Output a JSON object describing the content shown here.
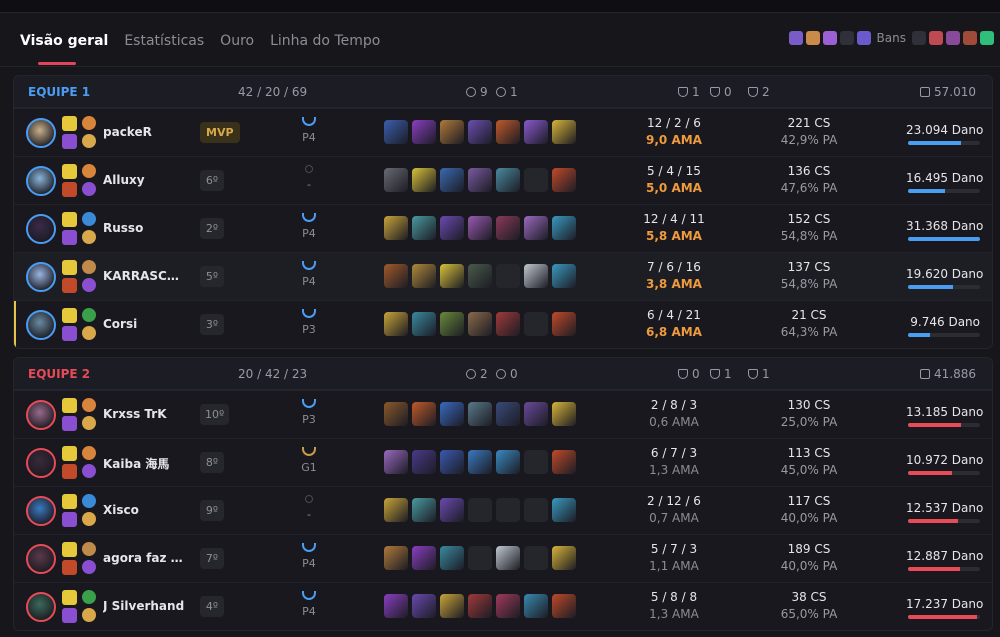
{
  "tabs": [
    "Visão geral",
    "Estatísticas",
    "Ouro",
    "Linha do Tempo"
  ],
  "bans_label": "Bans",
  "ban_colors": [
    "#7a5cc9",
    "#c98a4a",
    "#9d5fd4",
    "#30303a",
    "#6a5acd",
    "#30303a",
    "#c04a52",
    "#8a4a9a",
    "#a04a3a",
    "#2fbf7a"
  ],
  "teams": [
    {
      "name": "EQUIPE 1",
      "color": "#4a9df2",
      "kda": "42 / 20 / 69",
      "wards": "9",
      "objectives": "1",
      "barons": "1",
      "heralds": "0",
      "dragons": "2",
      "gold": "57.010",
      "players": [
        {
          "name": "packeR",
          "badge": "MVP",
          "rank": "P4",
          "kda": "12 / 2 / 6",
          "ratio": "9,0 AMA",
          "cs": "221 CS",
          "kp": "42,9% PA",
          "damage": "23.094 Dano",
          "damage_fraction": 0.74,
          "items": [
            "#3b5fae",
            "#8a3fc0",
            "#b07a3a",
            "#6a4fb0",
            "#c05a2a",
            "#8a5acd",
            "#d8b43a"
          ],
          "champ_color": "#c9b08a"
        },
        {
          "name": "Alluxy",
          "badge": "6º",
          "rank": "-",
          "kda": "5 / 4 / 15",
          "ratio": "5,0 AMA",
          "cs": "136 CS",
          "kp": "47,6% PA",
          "damage": "16.495 Dano",
          "damage_fraction": 0.52,
          "items": [
            "#6a6a72",
            "#d8c23a",
            "#3a6ab0",
            "#7a5aa0",
            "#4a8aa0",
            "",
            "#c04a2a"
          ],
          "champ_color": "#8ab4d8"
        },
        {
          "name": "Russo",
          "badge": "2º",
          "rank": "P4",
          "kda": "12 / 4 / 11",
          "ratio": "5,8 AMA",
          "cs": "152 CS",
          "kp": "54,8% PA",
          "damage": "31.368 Dano",
          "damage_fraction": 1.0,
          "items": [
            "#c9a43a",
            "#4a9aa0",
            "#6a4ab0",
            "#9a5ab0",
            "#8a3a5a",
            "#9a6ac0",
            "#3a9ac0"
          ],
          "champ_color": "#3a2a4a"
        },
        {
          "name": "KARRASCOd…",
          "badge": "5º",
          "rank": "P4",
          "kda": "7 / 6 / 16",
          "ratio": "3,8 AMA",
          "cs": "137 CS",
          "kp": "54,8% PA",
          "damage": "19.620 Dano",
          "damage_fraction": 0.62,
          "items": [
            "#a05a2a",
            "#b08a3a",
            "#d8c23a",
            "#4a5a4a",
            "",
            "#c0c8d0",
            "#3a9ac0"
          ],
          "champ_color": "#9ab4e0"
        },
        {
          "name": "Corsi",
          "badge": "3º",
          "rank": "P3",
          "kda": "6 / 4 / 21",
          "ratio": "6,8 AMA",
          "cs": "21 CS",
          "kp": "64,3% PA",
          "damage": "9.746 Dano",
          "damage_fraction": 0.31,
          "items": [
            "#c9a43a",
            "#3a8aa0",
            "#6a8a3a",
            "#8a6a4a",
            "#a03a3a",
            "",
            "#c04a2a"
          ],
          "champ_color": "#6a8aa0"
        }
      ]
    },
    {
      "name": "EQUIPE 2",
      "color": "#e84b58",
      "kda": "20 / 42 / 23",
      "wards": "2",
      "objectives": "0",
      "barons": "0",
      "heralds": "1",
      "dragons": "1",
      "gold": "41.886",
      "players": [
        {
          "name": "Krxss TrK",
          "badge": "10º",
          "rank": "P3",
          "kda": "2 / 8 / 3",
          "ratio": "0,6 AMA",
          "cs": "130 CS",
          "kp": "25,0% PA",
          "damage": "13.185 Dano",
          "damage_fraction": 0.73,
          "items": [
            "#8a5a2a",
            "#c05a2a",
            "#3a6ac0",
            "#5a7a8a",
            "#3a4a7a",
            "#6a4a9a",
            "#d8b43a"
          ],
          "champ_color": "#9a6a8a"
        },
        {
          "name": "Kaiba 海馬",
          "badge": "8º",
          "rank": "G1",
          "kda": "6 / 7 / 3",
          "ratio": "1,3 AMA",
          "cs": "113 CS",
          "kp": "45,0% PA",
          "damage": "10.972 Dano",
          "damage_fraction": 0.61,
          "items": [
            "#9a6ac0",
            "#4a3a8a",
            "#3a5ab0",
            "#3a7ac0",
            "#3a8ac0",
            "",
            "#c04a2a"
          ],
          "champ_color": "#3a2a3a"
        },
        {
          "name": "Xisco",
          "badge": "9º",
          "rank": "-",
          "kda": "2 / 12 / 6",
          "ratio": "0,7 AMA",
          "cs": "117 CS",
          "kp": "40,0% PA",
          "damage": "12.537 Dano",
          "damage_fraction": 0.7,
          "items": [
            "#c9a43a",
            "#4a9aa0",
            "#6a4ab0",
            "",
            "",
            "",
            "#3a9ac0"
          ],
          "champ_color": "#3a7ac0"
        },
        {
          "name": "agora faz o IIL",
          "badge": "7º",
          "rank": "P4",
          "kda": "5 / 7 / 3",
          "ratio": "1,1 AMA",
          "cs": "189 CS",
          "kp": "40,0% PA",
          "damage": "12.887 Dano",
          "damage_fraction": 0.72,
          "items": [
            "#b07a3a",
            "#8a3fc0",
            "#3a8aa0",
            "",
            "#c0c8d0",
            "",
            "#d8b43a"
          ],
          "champ_color": "#5a3a4a"
        },
        {
          "name": "J Silverhand",
          "badge": "4º",
          "rank": "P4",
          "kda": "5 / 8 / 8",
          "ratio": "1,3 AMA",
          "cs": "38 CS",
          "kp": "65,0% PA",
          "damage": "17.237 Dano",
          "damage_fraction": 0.96,
          "items": [
            "#8a3fc0",
            "#6a4ab0",
            "#c9a43a",
            "#a03a3a",
            "#a03a5a",
            "#3a8ab0",
            "#c04a2a"
          ],
          "champ_color": "#3a6a5a"
        }
      ]
    }
  ]
}
